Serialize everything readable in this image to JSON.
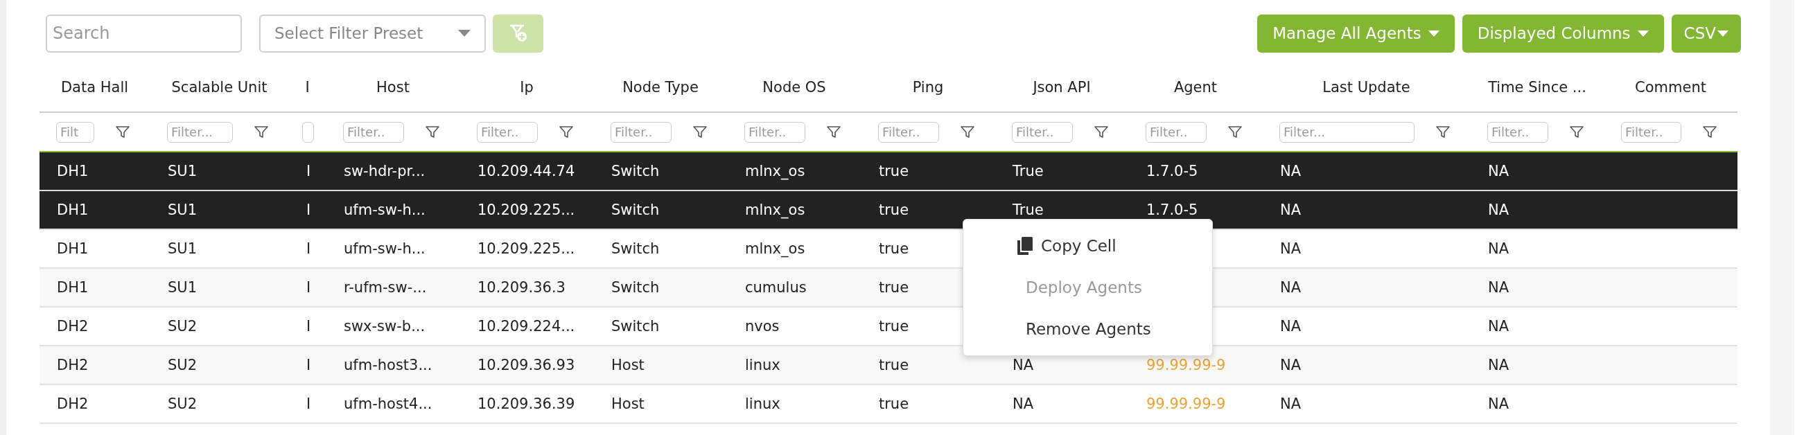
{
  "toolbar": {
    "search": {
      "placeholder": "Search"
    },
    "preset": {
      "placeholder": "Select Filter Preset"
    },
    "add_filter_button": {
      "disabled": true
    },
    "buttons": [
      "Manage All Agents",
      "Displayed Columns",
      "CSV"
    ]
  },
  "table": {
    "columns": [
      {
        "label": "Data Hall",
        "filter_placeholder": "Filt"
      },
      {
        "label": "Scalable Unit",
        "filter_placeholder": "Filter..."
      },
      {
        "label": "I"
      },
      {
        "label": "Host",
        "filter_placeholder": "Filter.."
      },
      {
        "label": "Ip",
        "filter_placeholder": "Filter.."
      },
      {
        "label": "Node Type",
        "filter_placeholder": "Filter.."
      },
      {
        "label": "Node OS",
        "filter_placeholder": "Filter.."
      },
      {
        "label": "Ping",
        "filter_placeholder": "Filter.."
      },
      {
        "label": "Json API",
        "filter_placeholder": "Filter.."
      },
      {
        "label": "Agent",
        "filter_placeholder": "Filter.."
      },
      {
        "label": "Last Update",
        "filter_placeholder": "Filter..."
      },
      {
        "label": "Time Since ...",
        "filter_placeholder": "Filter.."
      },
      {
        "label": "Comment",
        "filter_placeholder": "Filter.."
      }
    ],
    "rows": [
      {
        "selected": true,
        "agent_outdated": false,
        "cells": [
          "DH1",
          "SU1",
          "I",
          "sw-hdr-pr...",
          "10.209.44.74",
          "Switch",
          "mlnx_os",
          "true",
          "True",
          "1.7.0-5",
          "NA",
          "NA",
          null
        ]
      },
      {
        "selected": true,
        "agent_outdated": false,
        "cells": [
          "DH1",
          "SU1",
          "I",
          "ufm-sw-h...",
          "10.209.225...",
          "Switch",
          "mlnx_os",
          "true",
          "True",
          "1.7.0-5",
          "NA",
          "NA",
          null
        ]
      },
      {
        "selected": false,
        "cells": [
          "DH1",
          "SU1",
          "I",
          "ufm-sw-h...",
          "10.209.225...",
          "Switch",
          "mlnx_os",
          "true",
          null,
          null,
          "NA",
          "NA",
          null
        ]
      },
      {
        "selected": false,
        "cells": [
          "DH1",
          "SU1",
          "I",
          "r-ufm-sw-...",
          "10.209.36.3",
          "Switch",
          "cumulus",
          "true",
          null,
          null,
          "NA",
          "NA",
          null
        ]
      },
      {
        "selected": false,
        "cells": [
          "DH2",
          "SU2",
          "I",
          "swx-sw-b...",
          "10.209.224...",
          "Switch",
          "nvos",
          "true",
          null,
          null,
          "NA",
          "NA",
          null
        ]
      },
      {
        "selected": false,
        "agent_outdated": true,
        "cells": [
          "DH2",
          "SU2",
          "I",
          "ufm-host3...",
          "10.209.36.93",
          "Host",
          "linux",
          "true",
          "NA",
          "99.99.99-9",
          "NA",
          "NA",
          null
        ]
      },
      {
        "selected": false,
        "agent_outdated": true,
        "cells": [
          "DH2",
          "SU2",
          "I",
          "ufm-host4...",
          "10.209.36.39",
          "Host",
          "linux",
          "true",
          "NA",
          "99.99.99-9",
          "NA",
          "NA",
          null
        ]
      }
    ]
  },
  "context_menu": {
    "items": [
      {
        "label": "Copy Cell",
        "kind": "icon",
        "disabled": false
      },
      {
        "label": "Deploy Agents",
        "kind": "plain",
        "disabled": true
      },
      {
        "label": "Remove Agents",
        "kind": "plain",
        "disabled": false
      }
    ]
  }
}
